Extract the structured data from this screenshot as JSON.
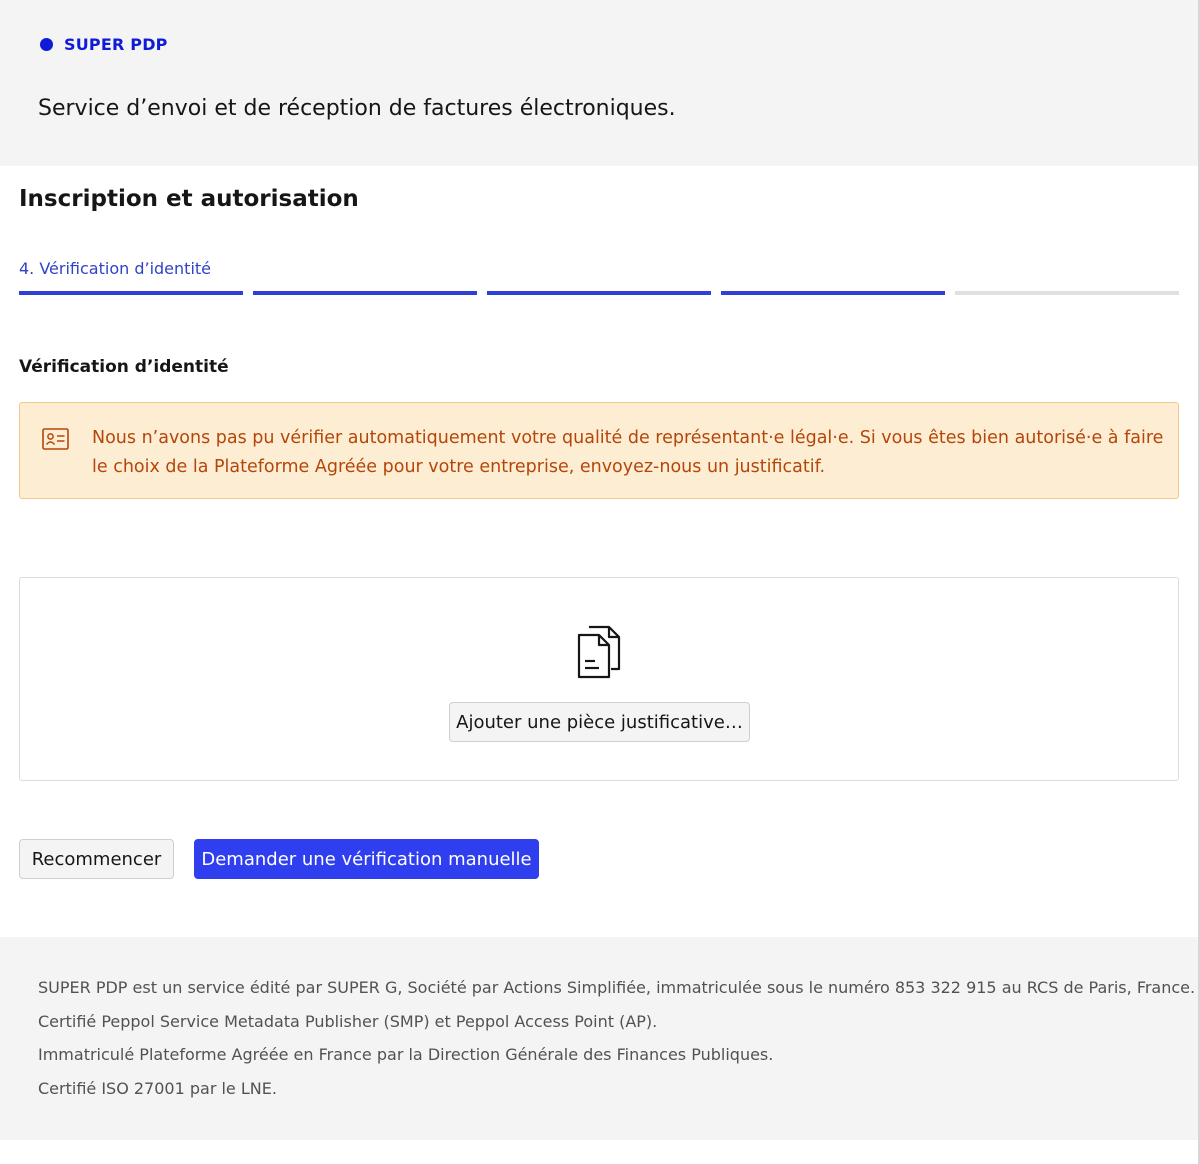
{
  "brand": {
    "name": "SUPER PDP",
    "color": "#0f1bd6"
  },
  "header": {
    "tagline": "Service d’envoi et de réception de factures électroniques."
  },
  "main": {
    "title": "Inscription et autorisation",
    "step_label": "4. Vérification d’identité",
    "progress": {
      "current_step": 4,
      "total_steps": 5
    },
    "section_title": "Vérification d’identité",
    "alert": {
      "icon": "id-card-icon",
      "text": "Nous n’avons pas pu vérifier automatiquement votre qualité de représentant·e légal·e. Si vous êtes bien autorisé·e à faire le choix de la Plateforme Agréée pour votre entreprise, envoyez-nous un justificatif."
    },
    "upload": {
      "icon": "documents-icon",
      "button_label": "Ajouter une pièce justificative…"
    },
    "actions": {
      "restart_label": "Recommencer",
      "manual_label": "Demander une vérification manuelle",
      "primary_color": "#2f3ff0"
    }
  },
  "footer": {
    "lines": [
      "SUPER PDP est un service édité par SUPER G, Société par Actions Simplifiée, immatriculée sous le numéro 853 322 915 au RCS de Paris, France.",
      "Certifié Peppol Service Metadata Publisher (SMP) et Peppol Access Point (AP).",
      "Immatriculé Plateforme Agréée en France par la Direction Générale des Finances Publiques.",
      "Certifié ISO 27001 par le LNE."
    ]
  }
}
